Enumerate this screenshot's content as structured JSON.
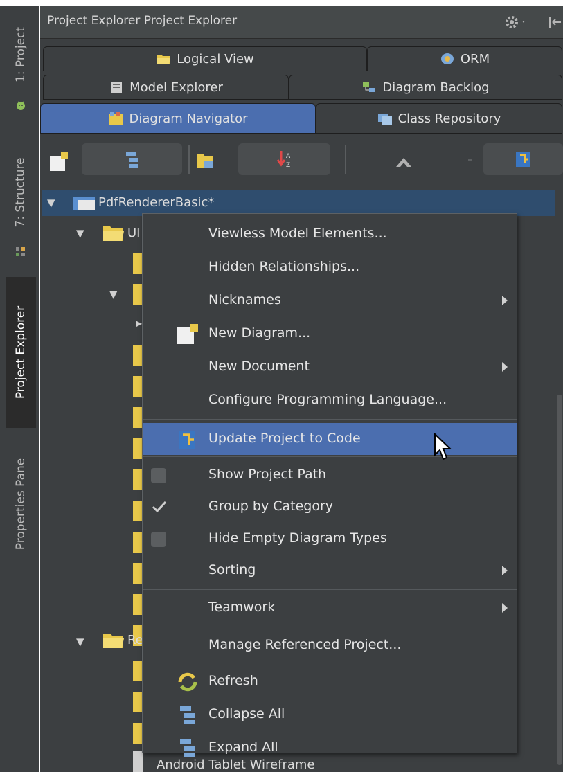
{
  "left_strip": {
    "tabs": [
      {
        "label": "1: Project"
      },
      {
        "label": "7: Structure"
      },
      {
        "label": "Project Explorer"
      },
      {
        "label": "Properties Pane"
      }
    ]
  },
  "panel": {
    "title": "Project Explorer Project Explorer",
    "tabs": {
      "logical_view": "Logical View",
      "orm": "ORM",
      "model_explorer": "Model Explorer",
      "diagram_backlog": "Diagram Backlog",
      "diagram_navigator": "Diagram Navigator",
      "class_repository": "Class Repository"
    }
  },
  "tree": {
    "root": "PdfRendererBasic*",
    "ui_folder": "UI",
    "ref_folder": "Re",
    "bottom_partial": "Android Tablet Wireframe"
  },
  "menu": {
    "items": {
      "viewless": "Viewless Model Elements...",
      "hidden_rel": "Hidden Relationships...",
      "nicknames": "Nicknames",
      "new_diagram": "New Diagram...",
      "new_document": "New Document",
      "configure_lang": "Configure Programming Language...",
      "update_project": "Update Project to Code",
      "show_path": "Show Project Path",
      "group_category": "Group by Category",
      "hide_empty": "Hide Empty Diagram Types",
      "sorting": "Sorting",
      "teamwork": "Teamwork",
      "manage_ref": "Manage Referenced Project...",
      "refresh": "Refresh",
      "collapse_all": "Collapse All",
      "expand_all": "Expand All"
    },
    "checked": {
      "show_path": false,
      "group_category": true,
      "hide_empty": false
    }
  },
  "colors": {
    "panel_bg": "#3c3f41",
    "selection": "#4b6eaf",
    "tree_selection": "#2f4d6e",
    "folder": "#e8c84a"
  },
  "icons": [
    "android-icon",
    "structure-icon",
    "gear-icon",
    "pin-icon",
    "folder-icon",
    "orm-icon",
    "model-explorer-icon",
    "diagram-backlog-icon",
    "diagram-navigator-icon",
    "class-repository-icon",
    "new-diagram-icon",
    "collapse-icon",
    "sort-icon",
    "up-arrow-icon",
    "update-code-icon",
    "refresh-icon",
    "expand-icon",
    "checkmark-icon",
    "cursor-icon"
  ]
}
